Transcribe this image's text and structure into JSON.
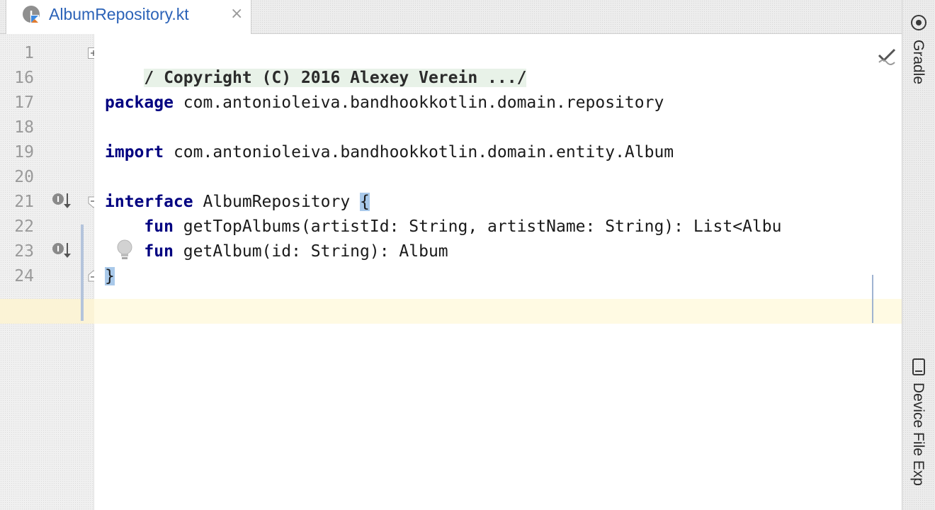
{
  "tab": {
    "label": "AlbumRepository.kt",
    "close_glyph": "×",
    "icon": "kotlin-interface-icon"
  },
  "gutter": {
    "line_numbers": [
      "1",
      "16",
      "17",
      "18",
      "19",
      "20",
      "21",
      "22",
      "23",
      "24"
    ],
    "icons": [
      "implemented-down-icon",
      "lightbulb-icon",
      "fold-plus-icon",
      "fold-minus-icon"
    ]
  },
  "code": {
    "line1": "/ Copyright (C) 2016 Alexey Verein .../",
    "line17_kw": "package",
    "line17_rest": " com.antonioleiva.bandhookkotlin.domain.repository",
    "line19_kw": "import",
    "line19_rest": " com.antonioleiva.bandhookkotlin.domain.entity.Album",
    "line21_kw": "interface",
    "line21_name": " AlbumRepository ",
    "line21_brace": "{",
    "line22_indent": "    ",
    "line22_kw": "fun",
    "line22_rest": " getTopAlbums(artistId: String, artistName: String): List<Albu",
    "line23_indent": "    ",
    "line23_kw": "fun",
    "line23_rest": " getAlbum(id: String): Album",
    "line24_brace": "}"
  },
  "right_toolbar": {
    "gradle_label": "Gradle",
    "device_explorer_label": "Device File Exp"
  },
  "colors": {
    "keyword": "#000080",
    "tab_text": "#2c63b8",
    "current_line": "#fffae3",
    "brace_highlight": "#a9c9ea"
  }
}
